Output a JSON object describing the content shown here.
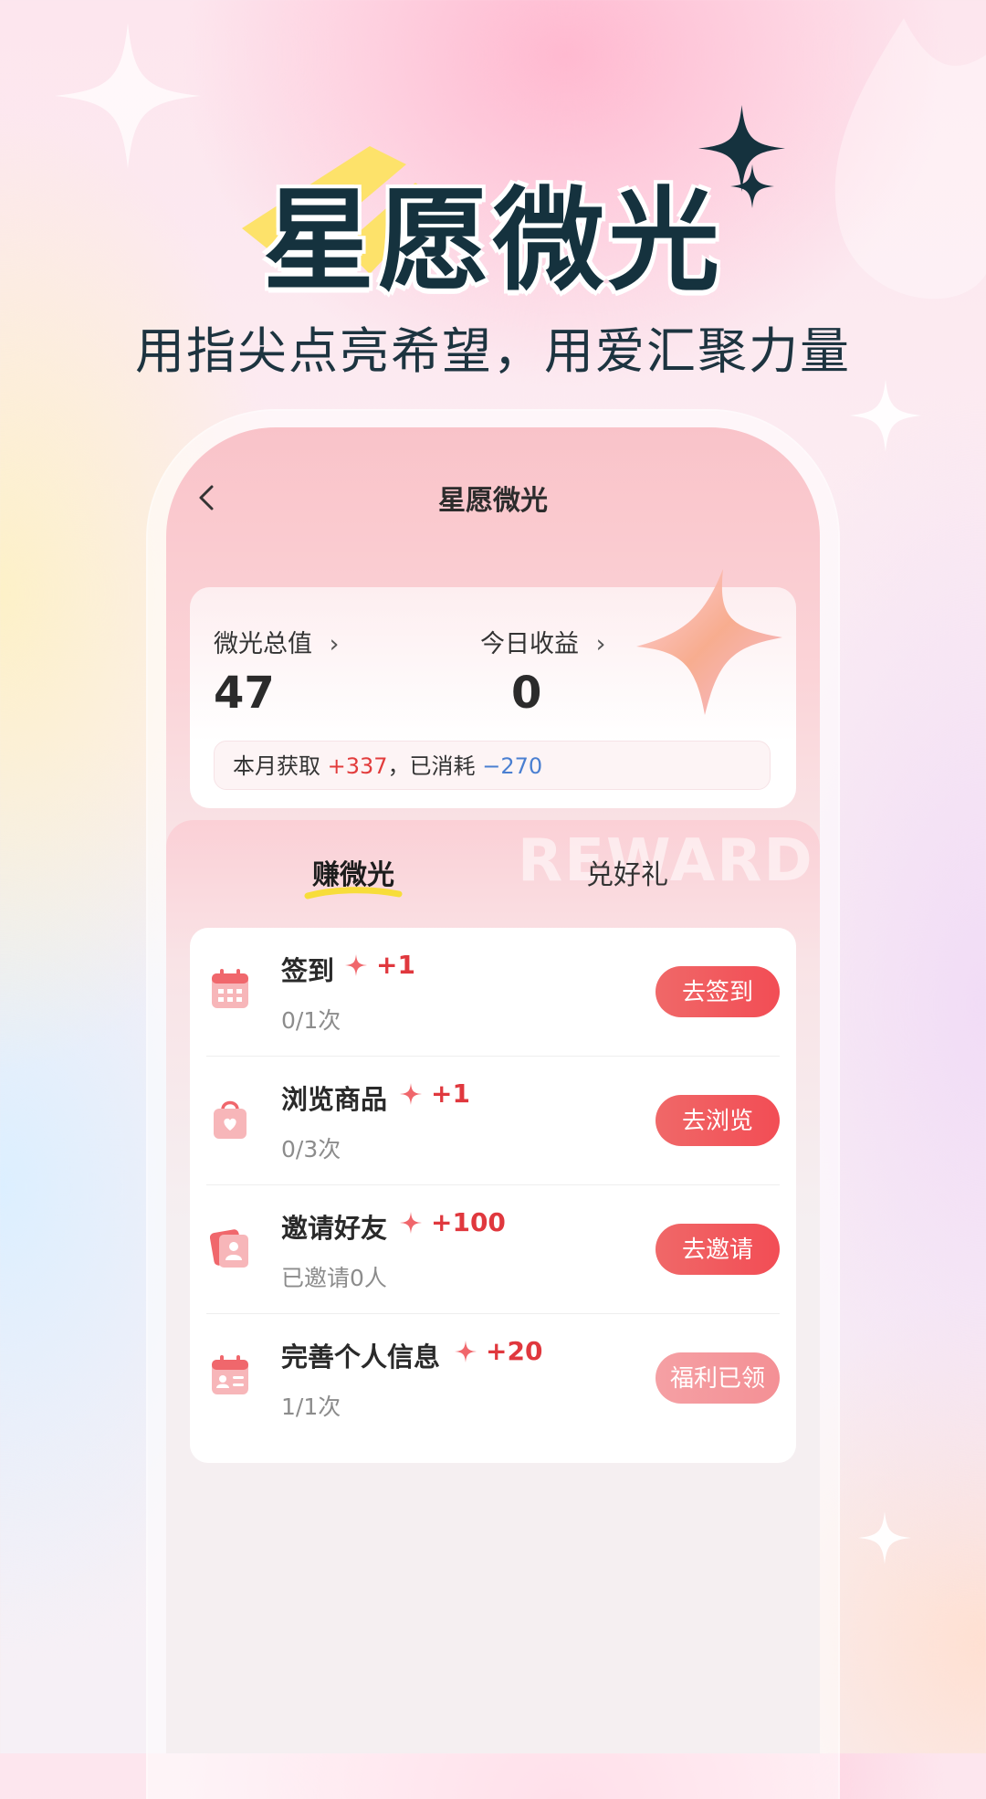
{
  "hero": {
    "title": "星愿微光",
    "subtitle": "用指尖点亮希望，用爱汇聚力量"
  },
  "nav": {
    "title": "星愿微光"
  },
  "summary": {
    "total_label": "微光总值",
    "total_value": "47",
    "today_label": "今日收益",
    "today_value": "0",
    "month_prefix": "本月获取 ",
    "month_gain": "+337",
    "month_mid": "，已消耗 ",
    "month_spent": "−270"
  },
  "tabs": {
    "earn": "赚微光",
    "redeem": "兑好礼",
    "watermark": "REWARD"
  },
  "tasks": [
    {
      "name": "签到",
      "reward": "+1",
      "progress": "0/1次",
      "button": "去签到",
      "icon": "calendar-icon"
    },
    {
      "name": "浏览商品",
      "reward": "+1",
      "progress": "0/3次",
      "button": "去浏览",
      "icon": "shopping-bag-icon"
    },
    {
      "name": "邀请好友",
      "reward": "+100",
      "progress": "已邀请0人",
      "button": "去邀请",
      "icon": "user-card-icon"
    },
    {
      "name": "完善个人信息",
      "reward": "+20",
      "progress": "1/1次",
      "button": "福利已领",
      "icon": "profile-calendar-icon"
    }
  ],
  "colors": {
    "accent": "#f24d55",
    "claimed": "#f49095",
    "title": "#15323e"
  }
}
